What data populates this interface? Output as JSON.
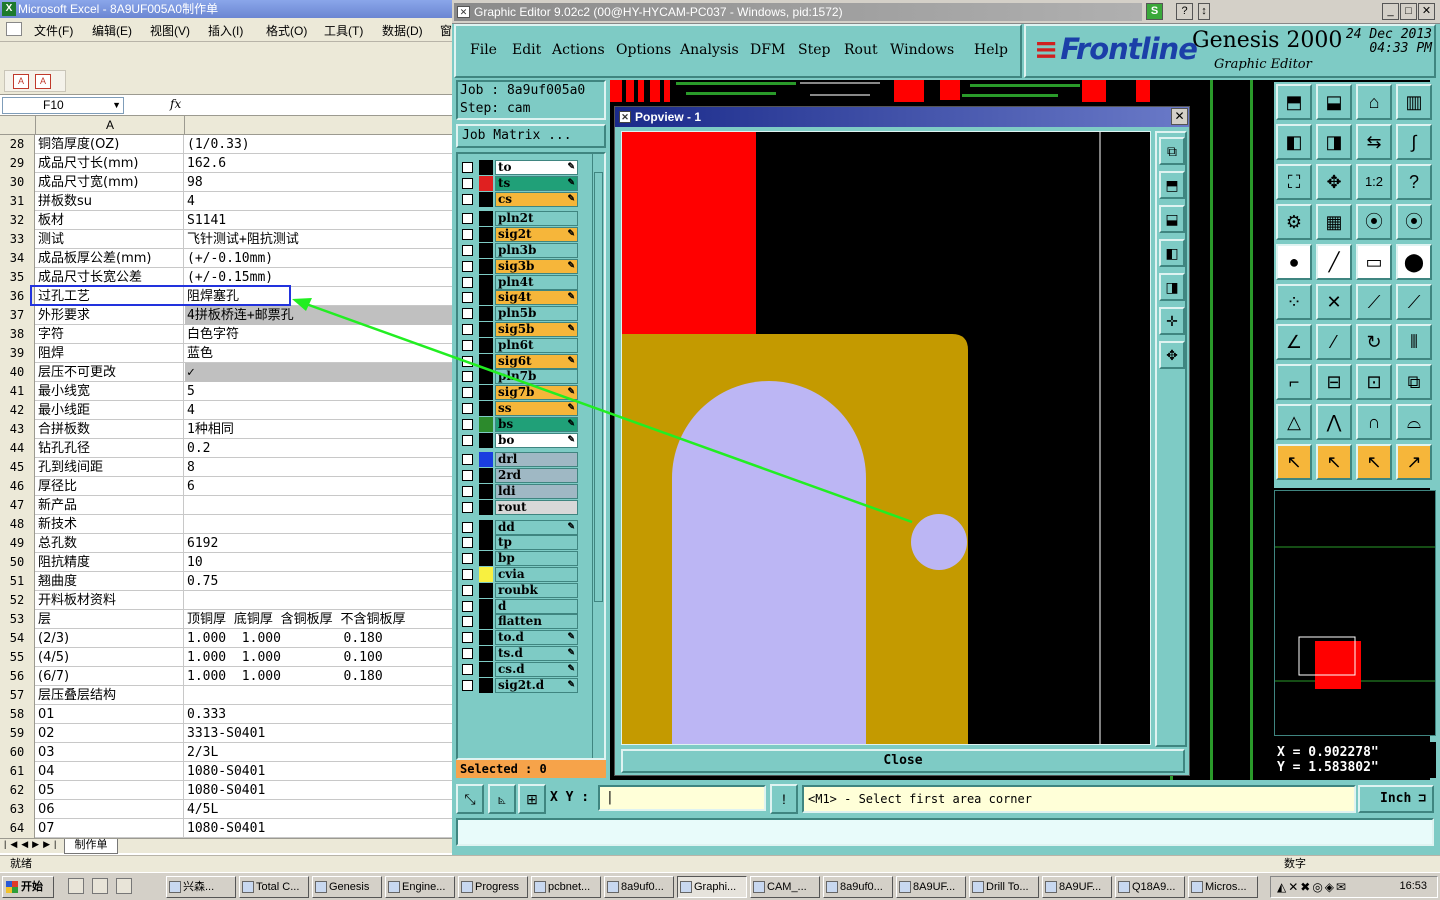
{
  "excel": {
    "title": "Microsoft Excel - 8A9UF005A0制作单",
    "menu": [
      "文件(F)",
      "编辑(E)",
      "视图(V)",
      "插入(I)",
      "格式(O)",
      "工具(T)",
      "数据(D)",
      "窗"
    ],
    "name_box": "F10",
    "fx": "fx",
    "column_a": "A",
    "rows": [
      {
        "n": "28",
        "a": "铜箔厚度(OZ)",
        "b": "(1/0.33)"
      },
      {
        "n": "29",
        "a": "成品尺寸长(mm)",
        "b": "162.6"
      },
      {
        "n": "30",
        "a": "成品尺寸宽(mm)",
        "b": "98"
      },
      {
        "n": "31",
        "a": "拼板数su",
        "b": "4"
      },
      {
        "n": "32",
        "a": "板材",
        "b": "S1141"
      },
      {
        "n": "33",
        "a": "测试",
        "b": "飞针测试+阻抗测试"
      },
      {
        "n": "34",
        "a": "成品板厚公差(mm)",
        "b": "(+/-0.10mm)"
      },
      {
        "n": "35",
        "a": "成品尺寸长宽公差",
        "b": "(+/-0.15mm)"
      },
      {
        "n": "36",
        "a": "过孔工艺",
        "b": "阻焊塞孔"
      },
      {
        "n": "37",
        "a": "外形要求",
        "b": "4拼板桥连+邮票孔"
      },
      {
        "n": "38",
        "a": "字符",
        "b": "白色字符"
      },
      {
        "n": "39",
        "a": "阻焊",
        "b": "蓝色"
      },
      {
        "n": "40",
        "a": "层压不可更改",
        "b": "✓"
      },
      {
        "n": "41",
        "a": "最小线宽",
        "b": "5"
      },
      {
        "n": "42",
        "a": "最小线距",
        "b": "4"
      },
      {
        "n": "43",
        "a": "合拼板数",
        "b": "1种相同"
      },
      {
        "n": "44",
        "a": "钻孔孔径",
        "b": "0.2"
      },
      {
        "n": "45",
        "a": "孔到线间距",
        "b": "8"
      },
      {
        "n": "46",
        "a": "厚径比",
        "b": "6"
      },
      {
        "n": "47",
        "a": "新产品",
        "b": ""
      },
      {
        "n": "48",
        "a": "新技术",
        "b": ""
      },
      {
        "n": "49",
        "a": "总孔数",
        "b": "6192"
      },
      {
        "n": "50",
        "a": "阻抗精度",
        "b": "10"
      },
      {
        "n": "51",
        "a": "翘曲度",
        "b": "0.75"
      },
      {
        "n": "52",
        "a": "开料板材资料",
        "b": ""
      },
      {
        "n": "53",
        "a": "层",
        "b": "顶铜厚 底铜厚 含铜板厚 不含铜板厚"
      },
      {
        "n": "54",
        "a": "(2/3)",
        "b": "1.000  1.000        0.180"
      },
      {
        "n": "55",
        "a": "(4/5)",
        "b": "1.000  1.000        0.100"
      },
      {
        "n": "56",
        "a": "(6/7)",
        "b": "1.000  1.000        0.180"
      },
      {
        "n": "57",
        "a": "层压叠层结构",
        "b": ""
      },
      {
        "n": "58",
        "a": "01",
        "b": "0.333"
      },
      {
        "n": "59",
        "a": "02",
        "b": "3313-S0401"
      },
      {
        "n": "60",
        "a": "03",
        "b": "2/3L"
      },
      {
        "n": "61",
        "a": "04",
        "b": "1080-S0401"
      },
      {
        "n": "62",
        "a": "05",
        "b": "1080-S0401"
      },
      {
        "n": "63",
        "a": "06",
        "b": "4/5L"
      },
      {
        "n": "64",
        "a": "07",
        "b": "1080-S0401"
      }
    ],
    "sheet_tab": "制作单",
    "status_left": "就绪",
    "status_right": "数字"
  },
  "genesis": {
    "title": "Graphic Editor 9.02c2 (00@HY-HYCAM-PC037 - Windows, pid:1572)",
    "menu": [
      "File",
      "Edit",
      "Actions",
      "Options",
      "Analysis",
      "DFM",
      "Step",
      "Rout",
      "Windows",
      "Help"
    ],
    "brand": "Frontline",
    "product": "Genesis 2000",
    "subtitle": "Graphic Editor",
    "date": "24 Dec 2013",
    "time": "04:33 PM",
    "job_label": "Job : 8a9uf005a0",
    "step_label": "Step: cam",
    "job_matrix": "Job Matrix ...",
    "layers": [
      {
        "name": "to",
        "color": "#ffffff",
        "swatch": "#000000",
        "pen": true
      },
      {
        "name": "ts",
        "color": "#20a078",
        "swatch": "#e02020",
        "pen": true
      },
      {
        "name": "cs",
        "color": "#f6b63a",
        "swatch": "#000000",
        "pen": true
      },
      {
        "name": "pln2t",
        "color": "#7ecbc5",
        "swatch": "#000000",
        "pen": false
      },
      {
        "name": "sig2t",
        "color": "#f6b63a",
        "swatch": "#000000",
        "pen": true
      },
      {
        "name": "pln3b",
        "color": "#7ecbc5",
        "swatch": "#000000",
        "pen": false
      },
      {
        "name": "sig3b",
        "color": "#f6b63a",
        "swatch": "#000000",
        "pen": true
      },
      {
        "name": "pln4t",
        "color": "#7ecbc5",
        "swatch": "#000000",
        "pen": false
      },
      {
        "name": "sig4t",
        "color": "#f6b63a",
        "swatch": "#000000",
        "pen": true
      },
      {
        "name": "pln5b",
        "color": "#7ecbc5",
        "swatch": "#000000",
        "pen": false
      },
      {
        "name": "sig5b",
        "color": "#f6b63a",
        "swatch": "#000000",
        "pen": true
      },
      {
        "name": "pln6t",
        "color": "#7ecbc5",
        "swatch": "#000000",
        "pen": false
      },
      {
        "name": "sig6t",
        "color": "#f6b63a",
        "swatch": "#000000",
        "pen": true
      },
      {
        "name": "pln7b",
        "color": "#7ecbc5",
        "swatch": "#000000",
        "pen": false
      },
      {
        "name": "sig7b",
        "color": "#f6b63a",
        "swatch": "#000000",
        "pen": true
      },
      {
        "name": "ss",
        "color": "#f6b63a",
        "swatch": "#000000",
        "pen": true
      },
      {
        "name": "bs",
        "color": "#20a078",
        "swatch": "#2c8a2c",
        "pen": true
      },
      {
        "name": "bo",
        "color": "#ffffff",
        "swatch": "#000000",
        "pen": true
      },
      {
        "name": "drl",
        "color": "#9fb8c4",
        "swatch": "#1a3ee0",
        "pen": false
      },
      {
        "name": "2rd",
        "color": "#9fb8c4",
        "swatch": "#000000",
        "pen": false
      },
      {
        "name": "ldi",
        "color": "#9fb8c4",
        "swatch": "#000000",
        "pen": false
      },
      {
        "name": "rout",
        "color": "#d8d8d8",
        "swatch": "#000000",
        "pen": false
      },
      {
        "name": "dd",
        "color": "#7ecbc5",
        "swatch": "#000000",
        "pen": true
      },
      {
        "name": "tp",
        "color": "#7ecbc5",
        "swatch": "#000000",
        "pen": false
      },
      {
        "name": "bp",
        "color": "#7ecbc5",
        "swatch": "#000000",
        "pen": false
      },
      {
        "name": "cvia",
        "color": "#7ecbc5",
        "swatch": "#f8f040",
        "pen": false
      },
      {
        "name": "roubk",
        "color": "#7ecbc5",
        "swatch": "#000000",
        "pen": false
      },
      {
        "name": "d",
        "color": "#7ecbc5",
        "swatch": "#000000",
        "pen": false
      },
      {
        "name": "flatten",
        "color": "#7ecbc5",
        "swatch": "#000000",
        "pen": false
      },
      {
        "name": "to.d",
        "color": "#7ecbc5",
        "swatch": "#000000",
        "pen": true
      },
      {
        "name": "ts.d",
        "color": "#7ecbc5",
        "swatch": "#000000",
        "pen": true
      },
      {
        "name": "cs.d",
        "color": "#7ecbc5",
        "swatch": "#000000",
        "pen": true
      },
      {
        "name": "sig2t.d",
        "color": "#7ecbc5",
        "swatch": "#000000",
        "pen": true
      }
    ],
    "selected_label": "Selected : 0",
    "popview_title": "Popview - 1",
    "close_label": "Close",
    "xy_label": "X Y :",
    "prompt": "<M1> - Select first area corner",
    "units": "Inch",
    "coord_x": "X = 0.902278\"",
    "coord_y": "Y = 1.583802\""
  },
  "taskbar": {
    "start": "开始",
    "tasks": [
      "兴森...",
      "Total C...",
      "Genesis",
      "Engine...",
      "Progress",
      "pcbnet...",
      "8a9uf0...",
      "Graphi...",
      "CAM_...",
      "8a9uf0...",
      "8A9UF...",
      "Drill To...",
      "8A9UF...",
      "Q18A9...",
      "Micros..."
    ],
    "active_task": 7,
    "clock": "16:53"
  },
  "colors": {
    "genesis_panel": "#7ecbc5",
    "copper": "#c49a00",
    "pad": "#bcb6f4",
    "red_layer": "#ff0000",
    "annotation_arrow": "#22ee22",
    "excel_selection": "#2233dd"
  }
}
